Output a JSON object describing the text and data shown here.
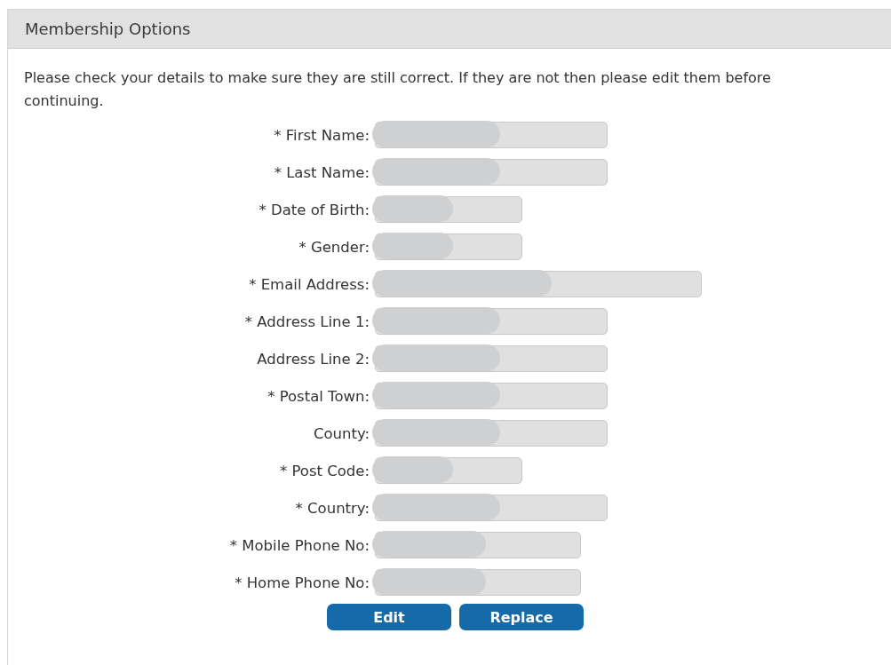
{
  "panel": {
    "title": "Membership Options"
  },
  "intro": "Please check your details to make sure they are still correct. If they are not then please edit them before continuing.",
  "fields": [
    {
      "label": "* First Name:",
      "kind": "medium",
      "redacted": true
    },
    {
      "label": "* Last Name:",
      "kind": "medium",
      "redacted": true
    },
    {
      "label": "* Date of Birth:",
      "kind": "short",
      "redacted": true
    },
    {
      "label": "* Gender:",
      "kind": "short",
      "redacted": true
    },
    {
      "label": "* Email Address:",
      "kind": "wide",
      "redacted": true
    },
    {
      "label": "* Address Line 1:",
      "kind": "medium",
      "redacted": true
    },
    {
      "label": "Address Line 2:",
      "kind": "medium",
      "redacted": true
    },
    {
      "label": "* Postal Town:",
      "kind": "medium",
      "redacted": true
    },
    {
      "label": "County:",
      "kind": "medium",
      "redacted": true
    },
    {
      "label": "* Post Code:",
      "kind": "short",
      "redacted": true
    },
    {
      "label": "* Country:",
      "kind": "medium",
      "redacted": true
    },
    {
      "label": "* Mobile Phone No:",
      "kind": "phone",
      "redacted": true
    },
    {
      "label": "* Home Phone No:",
      "kind": "phone",
      "redacted": true
    }
  ],
  "buttons": [
    "Edit",
    "Replace"
  ]
}
